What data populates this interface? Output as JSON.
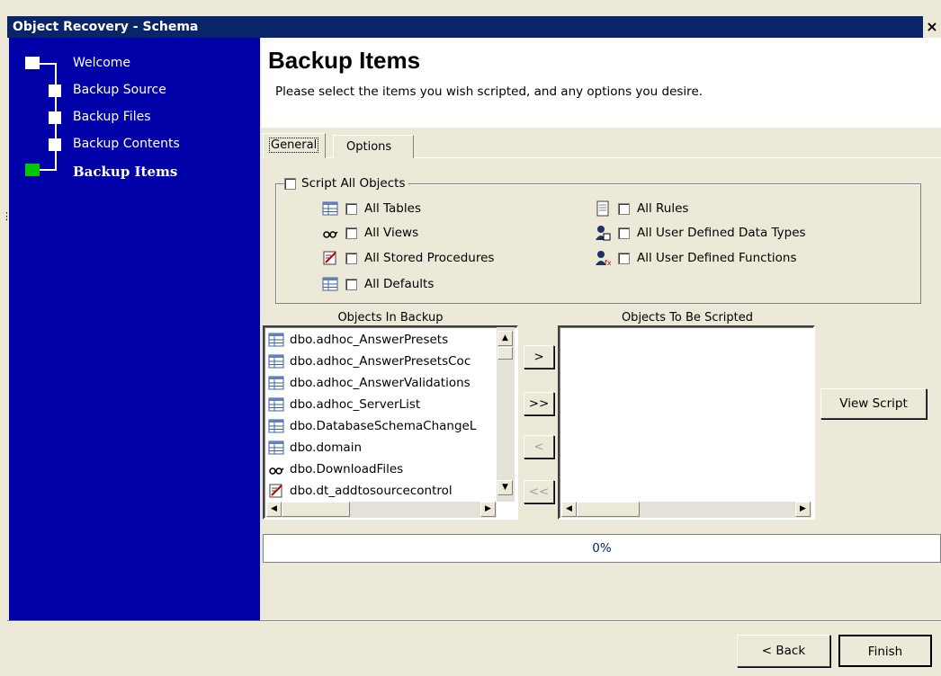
{
  "window": {
    "title": "Object Recovery - Schema",
    "close_glyph": "×"
  },
  "sidebar": {
    "steps": [
      {
        "label": "Welcome",
        "state": "done"
      },
      {
        "label": "Backup Source",
        "state": "done"
      },
      {
        "label": "Backup Files",
        "state": "done"
      },
      {
        "label": "Backup Contents",
        "state": "done"
      },
      {
        "label": "Backup Items",
        "state": "current"
      }
    ],
    "colors": {
      "background": "#0000a8",
      "current": "#00c800"
    }
  },
  "header": {
    "title": "Backup Items",
    "subtitle": "Please select the items you wish scripted, and any options you desire."
  },
  "tabs": [
    {
      "label": "General",
      "active": true
    },
    {
      "label": "Options",
      "active": false
    }
  ],
  "options": {
    "script_all": {
      "label": "Script All Objects",
      "checked": false
    },
    "left": [
      {
        "label": "All Tables",
        "icon": "table-icon",
        "checked": false
      },
      {
        "label": "All Views",
        "icon": "view-icon",
        "checked": false
      },
      {
        "label": "All Stored Procedures",
        "icon": "stored-procedure-icon",
        "checked": false
      },
      {
        "label": "All Defaults",
        "icon": "default-icon",
        "checked": false
      }
    ],
    "right": [
      {
        "label": "All Rules",
        "icon": "rule-icon",
        "checked": false
      },
      {
        "label": "All User Defined Data Types",
        "icon": "user-data-type-icon",
        "checked": false
      },
      {
        "label": "All User Defined Functions",
        "icon": "user-function-icon",
        "checked": false
      }
    ]
  },
  "objects_in_backup": {
    "caption": "Objects In Backup",
    "items": [
      {
        "label": "dbo.adhoc_AnswerPresets",
        "icon": "table-icon"
      },
      {
        "label": "dbo.adhoc_AnswerPresetsCoc",
        "icon": "table-icon"
      },
      {
        "label": "dbo.adhoc_AnswerValidations",
        "icon": "table-icon"
      },
      {
        "label": "dbo.adhoc_ServerList",
        "icon": "table-icon"
      },
      {
        "label": "dbo.DatabaseSchemaChangeL",
        "icon": "table-icon"
      },
      {
        "label": "dbo.domain",
        "icon": "table-icon"
      },
      {
        "label": "dbo.DownloadFiles",
        "icon": "view-icon"
      },
      {
        "label": "dbo.dt_addtosourcecontrol",
        "icon": "stored-procedure-icon"
      }
    ]
  },
  "objects_to_be_scripted": {
    "caption": "Objects To Be Scripted",
    "items": []
  },
  "transfer_buttons": {
    "add": ">",
    "add_all": ">>",
    "remove": "<",
    "remove_all": "<<"
  },
  "view_script_label": "View Script",
  "progress": {
    "text": "0%",
    "value": 0
  },
  "footer": {
    "back_label": "< Back",
    "finish_label": "Finish"
  }
}
